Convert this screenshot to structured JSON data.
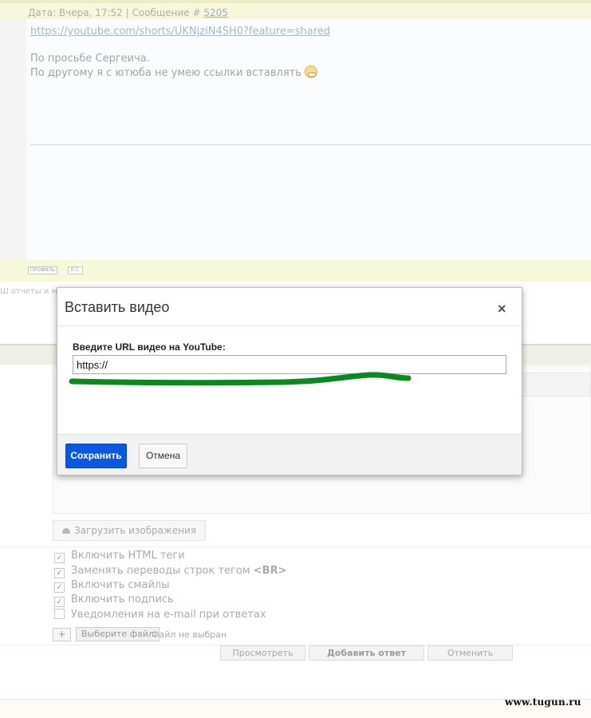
{
  "message": {
    "meta_prefix": "Дата: Вчера, 17:52 | Сообщение # ",
    "message_number": "5205",
    "link": "https://youtube.com/shorts/UKNjziN4SH0?feature=shared",
    "line1": "По просьбе Сергеича.",
    "line2": "По другому я с ютюба не умею ссылки вставлять",
    "emoticon": "grin-smiley-icon"
  },
  "message_footer": {
    "profile_label": "ПРОФИЛЬ",
    "pm_label": "Л.С."
  },
  "side_link_fragment": "Ш отчеты и м",
  "upload_button_label": "Загрузить изображения",
  "options": [
    {
      "label": "Включить HTML теги",
      "checked": true
    },
    {
      "label": "Заменять переводы строк тегом",
      "tag": "<BR>",
      "checked": true
    },
    {
      "label": "Включить смайлы",
      "checked": true
    },
    {
      "label": "Включить подпись",
      "checked": true
    },
    {
      "label": "Уведомления на e-mail при ответах",
      "checked": false
    }
  ],
  "file_upload": {
    "add_label": "+",
    "choose_label": "Выберите файл",
    "status": "Файл не выбран"
  },
  "form_buttons": {
    "preview": "Просмотреть",
    "submit": "Добавить ответ",
    "cancel": "Отменить"
  },
  "modal": {
    "title": "Вставить видео",
    "close_symbol": "×",
    "field_label": "Введите URL видео на YouTube:",
    "url_value": "https://",
    "save_label": "Сохранить",
    "cancel_label": "Отмена"
  },
  "annotation_color": "#0a8a1e",
  "watermark": "www.tugun.ru"
}
